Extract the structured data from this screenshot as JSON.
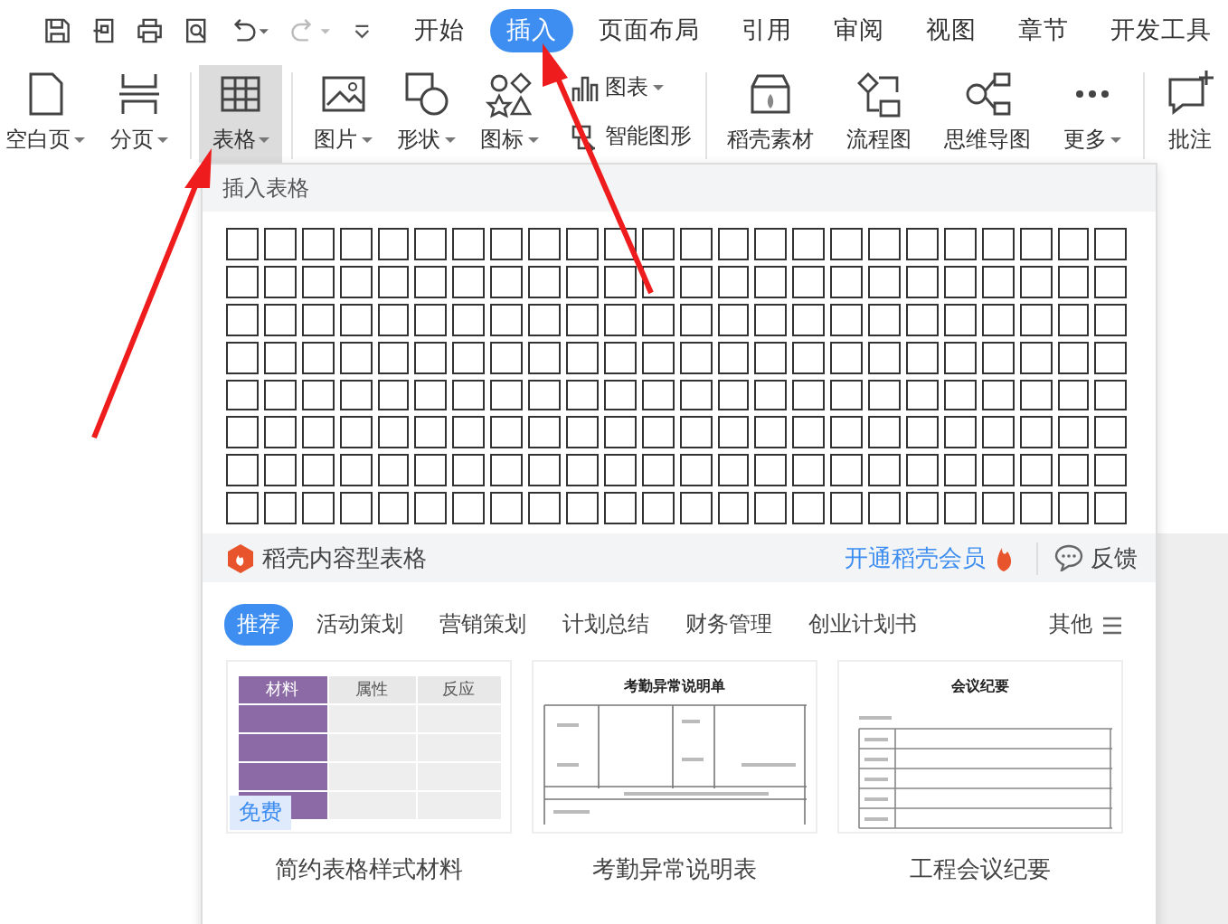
{
  "menu_tabs": [
    {
      "label": "开始",
      "selected": false
    },
    {
      "label": "插入",
      "selected": true
    },
    {
      "label": "页面布局",
      "selected": false
    },
    {
      "label": "引用",
      "selected": false
    },
    {
      "label": "审阅",
      "selected": false
    },
    {
      "label": "视图",
      "selected": false
    },
    {
      "label": "章节",
      "selected": false
    },
    {
      "label": "开发工具",
      "selected": false
    }
  ],
  "ribbon_groups": [
    {
      "buttons": [
        {
          "label": "空白页",
          "dropdown": true,
          "selected": false
        },
        {
          "label": "分页",
          "dropdown": true,
          "selected": false
        }
      ]
    },
    {
      "buttons": [
        {
          "label": "表格",
          "dropdown": true,
          "selected": true
        }
      ]
    },
    {
      "buttons": [
        {
          "label": "图片",
          "dropdown": true,
          "selected": false
        },
        {
          "label": "形状",
          "dropdown": true,
          "selected": false
        },
        {
          "label": "图标",
          "dropdown": true,
          "selected": false
        }
      ],
      "small_buttons": [
        {
          "label": "图表",
          "dropdown": true
        },
        {
          "label": "智能图形",
          "dropdown": false
        }
      ]
    },
    {
      "buttons": [
        {
          "label": "稻壳素材",
          "dropdown": false,
          "selected": false
        },
        {
          "label": "流程图",
          "dropdown": false,
          "selected": false
        },
        {
          "label": "思维导图",
          "dropdown": false,
          "selected": false
        },
        {
          "label": "更多",
          "dropdown": true,
          "selected": false
        }
      ]
    },
    {
      "buttons": [
        {
          "label": "批注",
          "dropdown": false,
          "selected": false
        }
      ]
    }
  ],
  "popup": {
    "title": "插入表格",
    "content_bar": {
      "label": "稻壳内容型表格",
      "member_link": "开通稻壳会员",
      "feedback": "反馈"
    },
    "categories": [
      {
        "label": "推荐",
        "selected": true
      },
      {
        "label": "活动策划",
        "selected": false
      },
      {
        "label": "营销策划",
        "selected": false
      },
      {
        "label": "计划总结",
        "selected": false
      },
      {
        "label": "财务管理",
        "selected": false
      },
      {
        "label": "创业计划书",
        "selected": false
      }
    ],
    "more": "其他",
    "templates": [
      {
        "kind": "table",
        "title": "简约表格样式材料",
        "badge": "免费",
        "headers": [
          "材料",
          "属性",
          "反应"
        ]
      },
      {
        "kind": "form",
        "title": "考勤异常说明表",
        "preview_title": "考勤异常说明单"
      },
      {
        "kind": "minutes",
        "title": "工程会议纪要",
        "preview_title": "会议纪要"
      }
    ]
  }
}
